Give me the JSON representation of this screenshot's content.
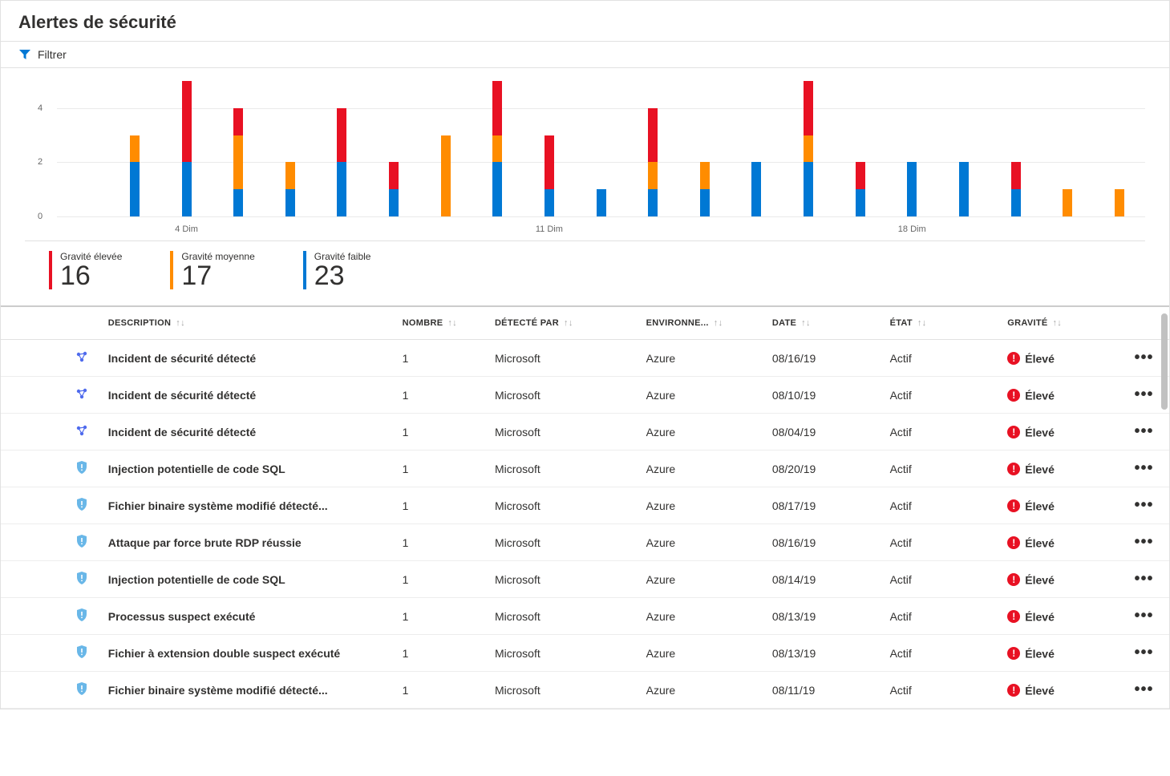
{
  "page_title": "Alertes de sécurité",
  "toolbar": {
    "filter_label": "Filtrer"
  },
  "chart_data": {
    "type": "bar",
    "ylabel": "",
    "ylim": [
      0,
      5
    ],
    "yticks": [
      0,
      2,
      4
    ],
    "xticks": [
      {
        "index": 3,
        "label": "4 Dim"
      },
      {
        "index": 10,
        "label": "11 Dim"
      },
      {
        "index": 17,
        "label": "18 Dim"
      }
    ],
    "series_names": [
      "low",
      "medium",
      "high"
    ],
    "colors": {
      "low": "#0078d4",
      "medium": "#ff8c00",
      "high": "#e81123"
    },
    "stacks": [
      {
        "day": 1,
        "low": 0,
        "medium": 0,
        "high": 0
      },
      {
        "day": 2,
        "low": 2,
        "medium": 1,
        "high": 0
      },
      {
        "day": 3,
        "low": 2,
        "medium": 0,
        "high": 3
      },
      {
        "day": 4,
        "low": 1,
        "medium": 2,
        "high": 1
      },
      {
        "day": 5,
        "low": 1,
        "medium": 1,
        "high": 0
      },
      {
        "day": 6,
        "low": 2,
        "medium": 0,
        "high": 2
      },
      {
        "day": 7,
        "low": 1,
        "medium": 0,
        "high": 1
      },
      {
        "day": 8,
        "low": 0,
        "medium": 3,
        "high": 0
      },
      {
        "day": 9,
        "low": 2,
        "medium": 1,
        "high": 2
      },
      {
        "day": 10,
        "low": 1,
        "medium": 0,
        "high": 2
      },
      {
        "day": 11,
        "low": 1,
        "medium": 0,
        "high": 0
      },
      {
        "day": 12,
        "low": 1,
        "medium": 1,
        "high": 2
      },
      {
        "day": 13,
        "low": 1,
        "medium": 1,
        "high": 0
      },
      {
        "day": 14,
        "low": 2,
        "medium": 0,
        "high": 0
      },
      {
        "day": 15,
        "low": 2,
        "medium": 1,
        "high": 2
      },
      {
        "day": 16,
        "low": 1,
        "medium": 0,
        "high": 1
      },
      {
        "day": 17,
        "low": 2,
        "medium": 0,
        "high": 0
      },
      {
        "day": 18,
        "low": 2,
        "medium": 0,
        "high": 0
      },
      {
        "day": 19,
        "low": 1,
        "medium": 0,
        "high": 1
      },
      {
        "day": 20,
        "low": 0,
        "medium": 1,
        "high": 0
      },
      {
        "day": 21,
        "low": 0,
        "medium": 1,
        "high": 0
      }
    ]
  },
  "summary": [
    {
      "label": "Gravité élevée",
      "value": "16",
      "class": "sev-high"
    },
    {
      "label": "Gravité moyenne",
      "value": "17",
      "class": "sev-med"
    },
    {
      "label": "Gravité faible",
      "value": "23",
      "class": "sev-low"
    }
  ],
  "table": {
    "columns": [
      {
        "key": "icon",
        "label": ""
      },
      {
        "key": "description",
        "label": "DESCRIPTION",
        "sortable": true
      },
      {
        "key": "count",
        "label": "NOMBRE",
        "sortable": true
      },
      {
        "key": "detected_by",
        "label": "DÉTECTÉ PAR",
        "sortable": true
      },
      {
        "key": "environment",
        "label": "ENVIRONNE...",
        "sortable": true
      },
      {
        "key": "date",
        "label": "DATE",
        "sortable": true
      },
      {
        "key": "state",
        "label": "ÉTAT",
        "sortable": true
      },
      {
        "key": "severity",
        "label": "GRAVITÉ",
        "sortable": true
      },
      {
        "key": "actions",
        "label": ""
      }
    ],
    "rows": [
      {
        "icon": "incident",
        "description": "Incident de sécurité détecté",
        "count": "1",
        "detected_by": "Microsoft",
        "environment": "Azure",
        "date": "08/16/19",
        "state": "Actif",
        "severity": "Élevé"
      },
      {
        "icon": "incident",
        "description": "Incident de sécurité détecté",
        "count": "1",
        "detected_by": "Microsoft",
        "environment": "Azure",
        "date": "08/10/19",
        "state": "Actif",
        "severity": "Élevé"
      },
      {
        "icon": "incident",
        "description": "Incident de sécurité détecté",
        "count": "1",
        "detected_by": "Microsoft",
        "environment": "Azure",
        "date": "08/04/19",
        "state": "Actif",
        "severity": "Élevé"
      },
      {
        "icon": "shield",
        "description": "Injection potentielle de code SQL",
        "count": "1",
        "detected_by": "Microsoft",
        "environment": "Azure",
        "date": "08/20/19",
        "state": "Actif",
        "severity": "Élevé"
      },
      {
        "icon": "shield",
        "description": "Fichier binaire système modifié détecté...",
        "count": "1",
        "detected_by": "Microsoft",
        "environment": "Azure",
        "date": "08/17/19",
        "state": "Actif",
        "severity": "Élevé"
      },
      {
        "icon": "shield",
        "description": "Attaque par force brute RDP réussie",
        "count": "1",
        "detected_by": "Microsoft",
        "environment": "Azure",
        "date": "08/16/19",
        "state": "Actif",
        "severity": "Élevé"
      },
      {
        "icon": "shield",
        "description": "Injection potentielle de code SQL",
        "count": "1",
        "detected_by": "Microsoft",
        "environment": "Azure",
        "date": "08/14/19",
        "state": "Actif",
        "severity": "Élevé"
      },
      {
        "icon": "shield",
        "description": "Processus suspect exécuté",
        "count": "1",
        "detected_by": "Microsoft",
        "environment": "Azure",
        "date": "08/13/19",
        "state": "Actif",
        "severity": "Élevé"
      },
      {
        "icon": "shield",
        "description": "Fichier à extension double suspect exécuté",
        "count": "1",
        "detected_by": "Microsoft",
        "environment": "Azure",
        "date": "08/13/19",
        "state": "Actif",
        "severity": "Élevé"
      },
      {
        "icon": "shield",
        "description": "Fichier binaire système modifié détecté...",
        "count": "1",
        "detected_by": "Microsoft",
        "environment": "Azure",
        "date": "08/11/19",
        "state": "Actif",
        "severity": "Élevé"
      }
    ]
  }
}
